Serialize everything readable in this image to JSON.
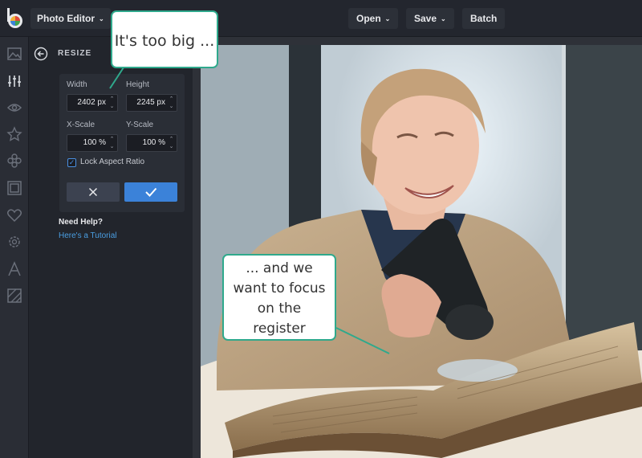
{
  "topbar": {
    "app_menu_label": "Photo Editor",
    "open_label": "Open",
    "save_label": "Save",
    "batch_label": "Batch"
  },
  "rail": {
    "icons": [
      "image-icon",
      "adjust-sliders-icon",
      "eye-icon",
      "star-icon",
      "shapes-icon",
      "frame-icon",
      "heart-icon",
      "gear-icon",
      "text-icon",
      "texture-icon"
    ]
  },
  "panel": {
    "title": "RESIZE",
    "width_label": "Width",
    "height_label": "Height",
    "width_value": "2402 px",
    "height_value": "2245 px",
    "xscale_label": "X-Scale",
    "yscale_label": "Y-Scale",
    "xscale_value": "100 %",
    "yscale_value": "100 %",
    "lock_label": "Lock Aspect Ratio",
    "lock_checked": true,
    "help_title": "Need Help?",
    "help_link": "Here's a Tutorial"
  },
  "callouts": {
    "first": "It's too big ...",
    "second_lines": [
      "... and we",
      "want to focus",
      "on the",
      "register"
    ]
  },
  "colors": {
    "accent": "#3b82d9",
    "callout_border": "#2fa98c"
  }
}
